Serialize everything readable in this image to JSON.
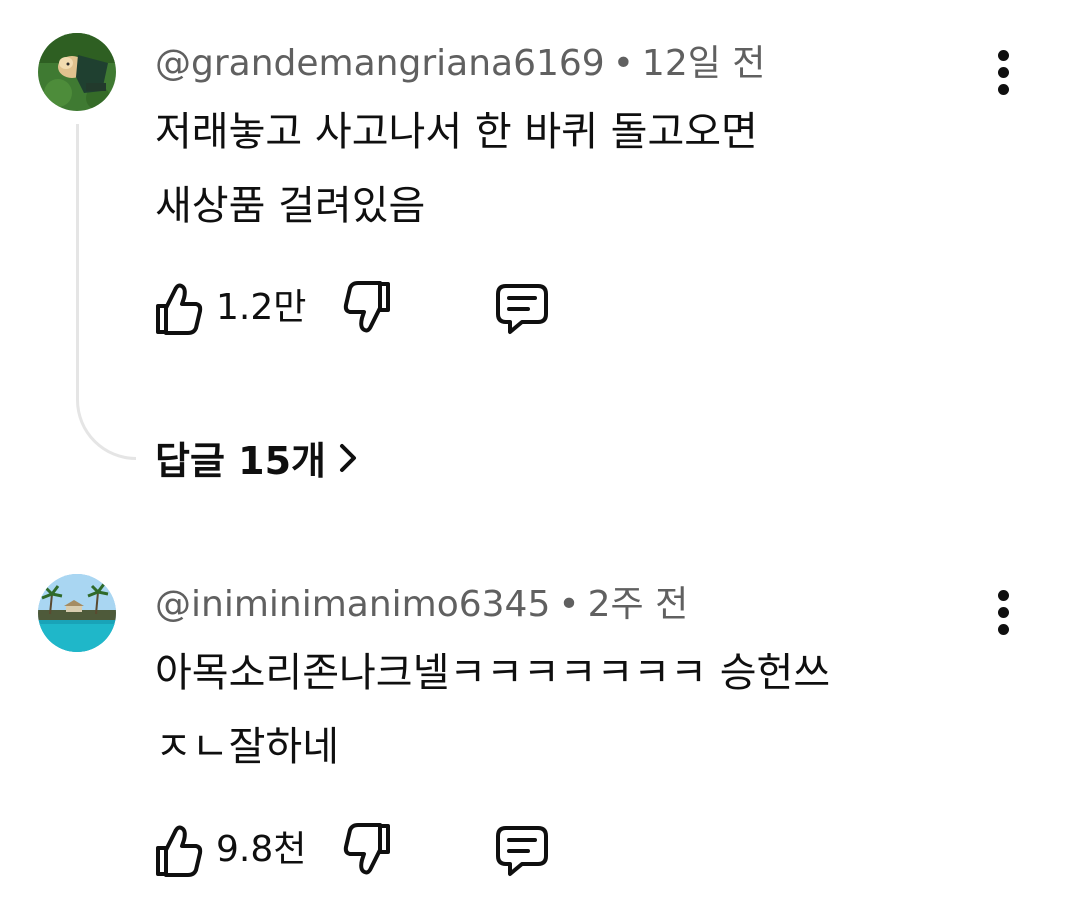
{
  "comments": [
    {
      "username": "@grandemangriana6169",
      "time": "12일 전",
      "lines": [
        "저래놓고 사고나서 한 바퀴 돌고오면",
        "새상품 걸려있음"
      ],
      "likes": "1.2만",
      "replies_label": "답글 15개"
    },
    {
      "username": "@iniminimanimo6345",
      "time": "2주 전",
      "lines": [
        "아목소리존나크넬ㅋㅋㅋㅋㅋㅋㅋ 승헌쓰",
        "ㅈㄴ잘하네"
      ],
      "likes": "9.8천"
    }
  ],
  "separator": "•",
  "icons": {
    "like": "thumb-up-icon",
    "dislike": "thumb-down-icon",
    "reply": "comment-icon",
    "more": "more-vertical-icon",
    "chevron": "chevron-right-icon"
  },
  "colors": {
    "text": "#0f0f0f",
    "meta": "#606060",
    "thread_line": "#e5e5e5"
  }
}
